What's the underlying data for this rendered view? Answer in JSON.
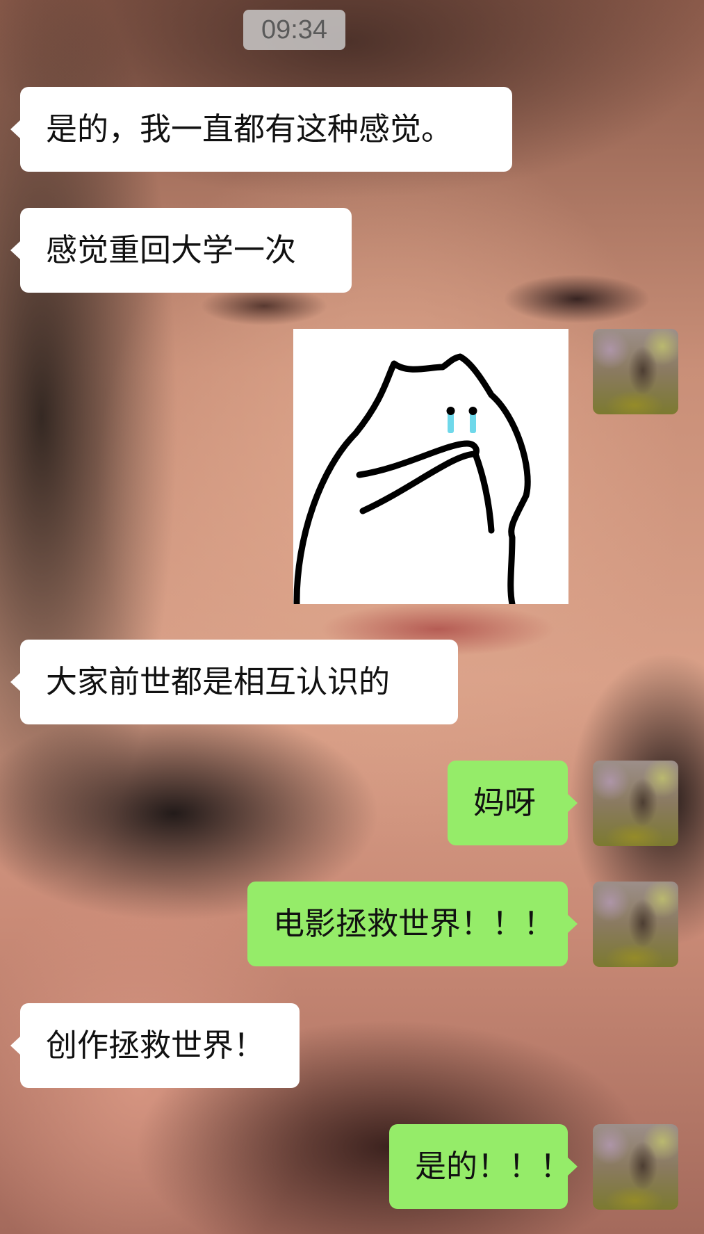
{
  "chat": {
    "timestamp": "09:34",
    "messages": [
      {
        "side": "left",
        "type": "text",
        "text": "是的，我一直都有这种感觉。"
      },
      {
        "side": "left",
        "type": "text",
        "text": "感觉重回大学一次"
      },
      {
        "side": "right",
        "type": "sticker",
        "sticker": "crying-cat-sticker"
      },
      {
        "side": "left",
        "type": "text",
        "text": "大家前世都是相互认识的"
      },
      {
        "side": "right",
        "type": "text",
        "text": "妈呀"
      },
      {
        "side": "right",
        "type": "text",
        "text": "电影拯救世界！！！"
      },
      {
        "side": "left",
        "type": "text",
        "text": "创作拯救世界！"
      },
      {
        "side": "right",
        "type": "text",
        "text": "是的！！！"
      }
    ]
  },
  "colors": {
    "incoming_bubble": "#ffffff",
    "outgoing_bubble": "#95ec69",
    "timestamp_badge": "#cdcdcd",
    "tear_icon": "#6fd8ea"
  }
}
